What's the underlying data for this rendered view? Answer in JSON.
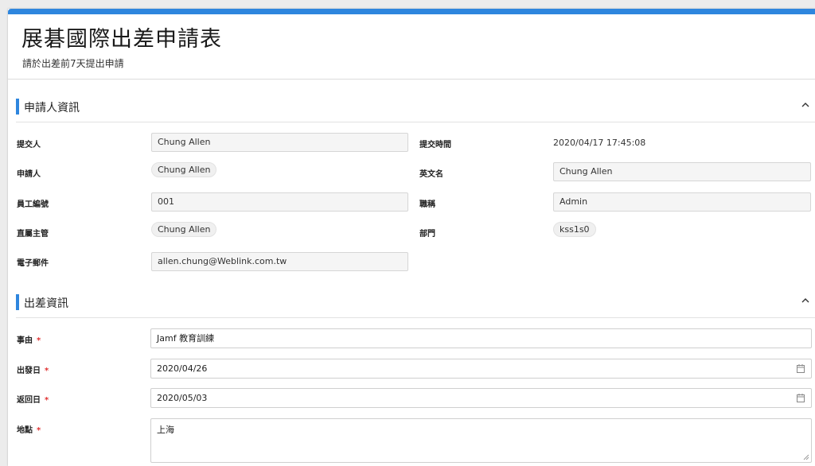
{
  "header": {
    "title": "展碁國際出差申請表",
    "subtitle": "請於出差前7天提出申請"
  },
  "sections": {
    "applicant": {
      "title": "申請人資訊"
    },
    "trip": {
      "title": "出差資訊"
    }
  },
  "applicant": {
    "submitter": {
      "label": "提交人",
      "value": "Chung Allen"
    },
    "submit_time": {
      "label": "提交時間",
      "value": "2020/04/17 17:45:08"
    },
    "applicant": {
      "label": "申請人",
      "value": "Chung Allen"
    },
    "english_name": {
      "label": "英文名",
      "value": "Chung Allen"
    },
    "employee_id": {
      "label": "員工編號",
      "value": "001"
    },
    "job_title": {
      "label": "職稱",
      "value": "Admin"
    },
    "supervisor": {
      "label": "直屬主管",
      "value": "Chung Allen"
    },
    "department": {
      "label": "部門",
      "value": "kss1s0"
    },
    "email": {
      "label": "電子郵件",
      "value": "allen.chung@Weblink.com.tw"
    }
  },
  "trip": {
    "reason": {
      "label": "事由",
      "value": "Jamf 教育訓練"
    },
    "depart_date": {
      "label": "出發日",
      "value": "2020/04/26"
    },
    "return_date": {
      "label": "返回日",
      "value": "2020/05/03"
    },
    "location": {
      "label": "地點",
      "value": "上海"
    },
    "required_mark": "*"
  },
  "colors": {
    "accent": "#2e86de",
    "required": "#e03131"
  },
  "icons": {
    "collapse": "chevron-up-icon",
    "calendar": "calendar-icon",
    "resize": "resize-handle-icon"
  }
}
